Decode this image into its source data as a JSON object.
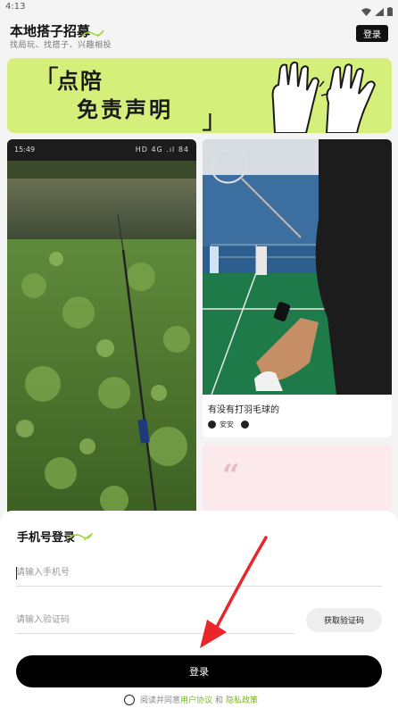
{
  "status_bar": {
    "time": "4:13"
  },
  "header": {
    "title": "本地搭子招募",
    "subtitle": "找局玩、找搭子、兴趣相投",
    "login_label": "登录"
  },
  "banner": {
    "line1": "点陪",
    "line2": "免责声明",
    "bracket_open": "「",
    "bracket_close": "」"
  },
  "feed": {
    "left_card": {
      "phone_status_time": "15:49",
      "phone_status_right": "HD 4G .ıl 84"
    },
    "right_card": {
      "caption": "有没有打羽毛球的",
      "author": "安安"
    },
    "right_card2": {
      "quote_mark": "“"
    }
  },
  "login_sheet": {
    "title": "手机号登录",
    "phone_placeholder": "请输入手机号",
    "code_placeholder": "请输入验证码",
    "get_code_label": "获取验证码",
    "submit_label": "登录",
    "agree_prefix": "阅读并同意",
    "user_agreement": "用户协议",
    "conjunction": "和",
    "privacy_policy": "隐私政策"
  },
  "colors": {
    "accent_green": "#7ab51d",
    "banner_bg": "#d5ef7b",
    "arrow_red": "#e8262b"
  }
}
